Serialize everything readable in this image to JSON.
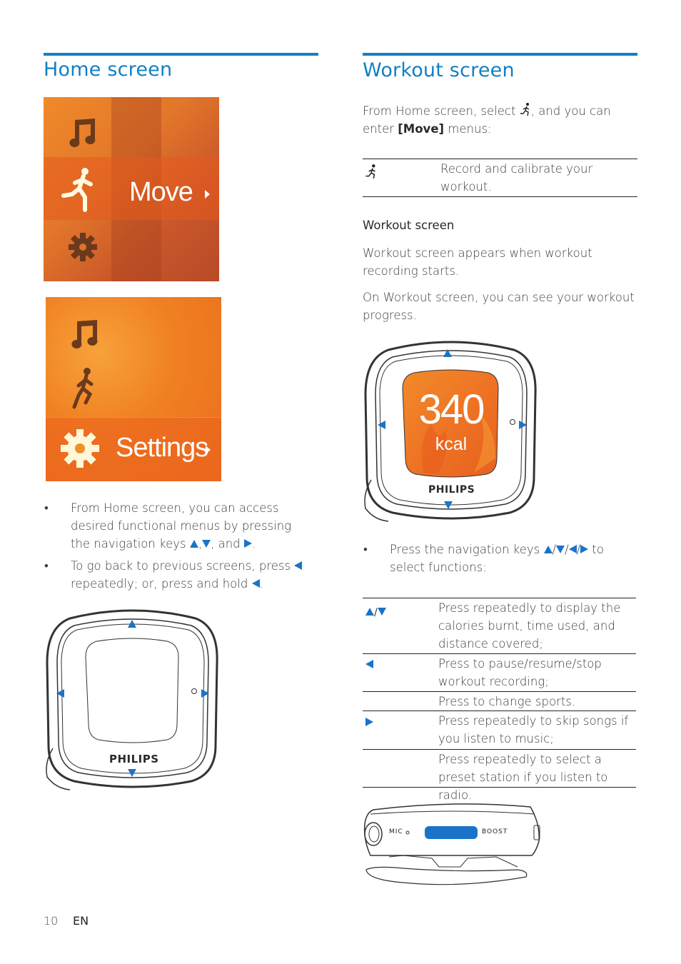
{
  "page": {
    "number": "10",
    "language": "EN",
    "accent_color": "#1280c4"
  },
  "home": {
    "title": "Home screen",
    "screen1": {
      "icons": [
        "music-note-icon",
        "runner-icon",
        "gear-icon"
      ],
      "selected_label": "Move"
    },
    "screen2": {
      "icons": [
        "music-note-icon",
        "runner-icon",
        "gear-icon"
      ],
      "selected_label": "Settings"
    },
    "bullets": [
      {
        "text_before": "From Home screen, you can access desired functional menus by pressing the navigation keys ",
        "keys": [
          "up",
          "down",
          "right"
        ],
        "sep1": ",",
        "sep2": ", and ",
        "end": "."
      },
      {
        "text_before": "To go back to previous screens, press ",
        "mid": " repeatedly; or, press and hold ",
        "end": "."
      }
    ],
    "device": {
      "brand": "PHILIPS"
    }
  },
  "workout": {
    "title": "Workout screen",
    "intro_before": "From Home screen, select ",
    "intro_after": ", and you can enter ",
    "intro_bold": "[Move]",
    "intro_end": " menus:",
    "move_table": [
      {
        "icon": "runner-icon",
        "text": "Record and calibrate your workout."
      }
    ],
    "subheading": "Workout screen",
    "para1": "Workout screen appears when workout recording starts.",
    "para2": "On Workout screen, you can see your workout progress.",
    "device": {
      "brand": "PHILIPS",
      "value": "340",
      "unit": "kcal"
    },
    "bullet": {
      "before": "Press the navigation keys ",
      "after": " to select functions:"
    },
    "keys_table": [
      {
        "keys": "up/down",
        "text": "Press repeatedly to display the calories burnt, time used, and distance covered;"
      },
      {
        "keys": "left",
        "text": "Press to pause/resume/stop workout recording;"
      },
      {
        "keys": "",
        "text": "Press to change sports."
      },
      {
        "keys": "right",
        "text": "Press repeatedly to skip songs if you listen to music;"
      },
      {
        "keys": "",
        "text": "Press repeatedly to select a preset station if you listen to radio."
      }
    ],
    "side_device": {
      "mic_label": "MIC",
      "boost_label": "BOOST"
    }
  }
}
